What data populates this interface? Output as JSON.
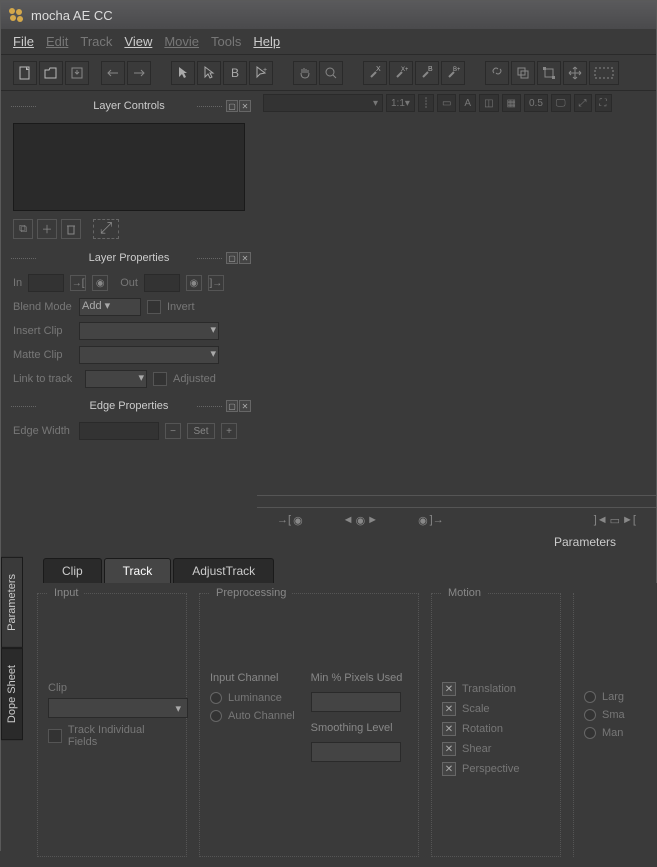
{
  "title": "mocha AE CC",
  "menu": {
    "file": "File",
    "edit": "Edit",
    "track": "Track",
    "view": "View",
    "movie": "Movie",
    "tools": "Tools",
    "help": "Help"
  },
  "panels": {
    "layer_controls": "Layer Controls",
    "layer_properties": "Layer Properties",
    "edge_properties": "Edge Properties"
  },
  "props": {
    "in": "In",
    "out": "Out",
    "blend_mode": "Blend Mode",
    "blend_value": "Add",
    "invert": "Invert",
    "insert_clip": "Insert Clip",
    "matte_clip": "Matte Clip",
    "link_to_track": "Link to track",
    "adjusted": "Adjusted",
    "edge_width": "Edge Width",
    "set": "Set"
  },
  "viewport": {
    "zoom": "1:1",
    "opacity": "0.5"
  },
  "params_label": "Parameters",
  "side_tabs": {
    "parameters": "Parameters",
    "dope": "Dope Sheet"
  },
  "tabs": {
    "clip": "Clip",
    "track": "Track",
    "adjust": "AdjustTrack"
  },
  "track_panel": {
    "input": "Input",
    "preprocessing": "Preprocessing",
    "motion": "Motion",
    "clip": "Clip",
    "track_individual": "Track Individual Fields",
    "input_channel": "Input Channel",
    "luminance": "Luminance",
    "auto_channel": "Auto Channel",
    "min_pixels": "Min % Pixels Used",
    "smoothing": "Smoothing Level",
    "translation": "Translation",
    "scale": "Scale",
    "rotation": "Rotation",
    "shear": "Shear",
    "perspective": "Perspective",
    "large": "Larg",
    "small": "Sma",
    "manual": "Man"
  }
}
